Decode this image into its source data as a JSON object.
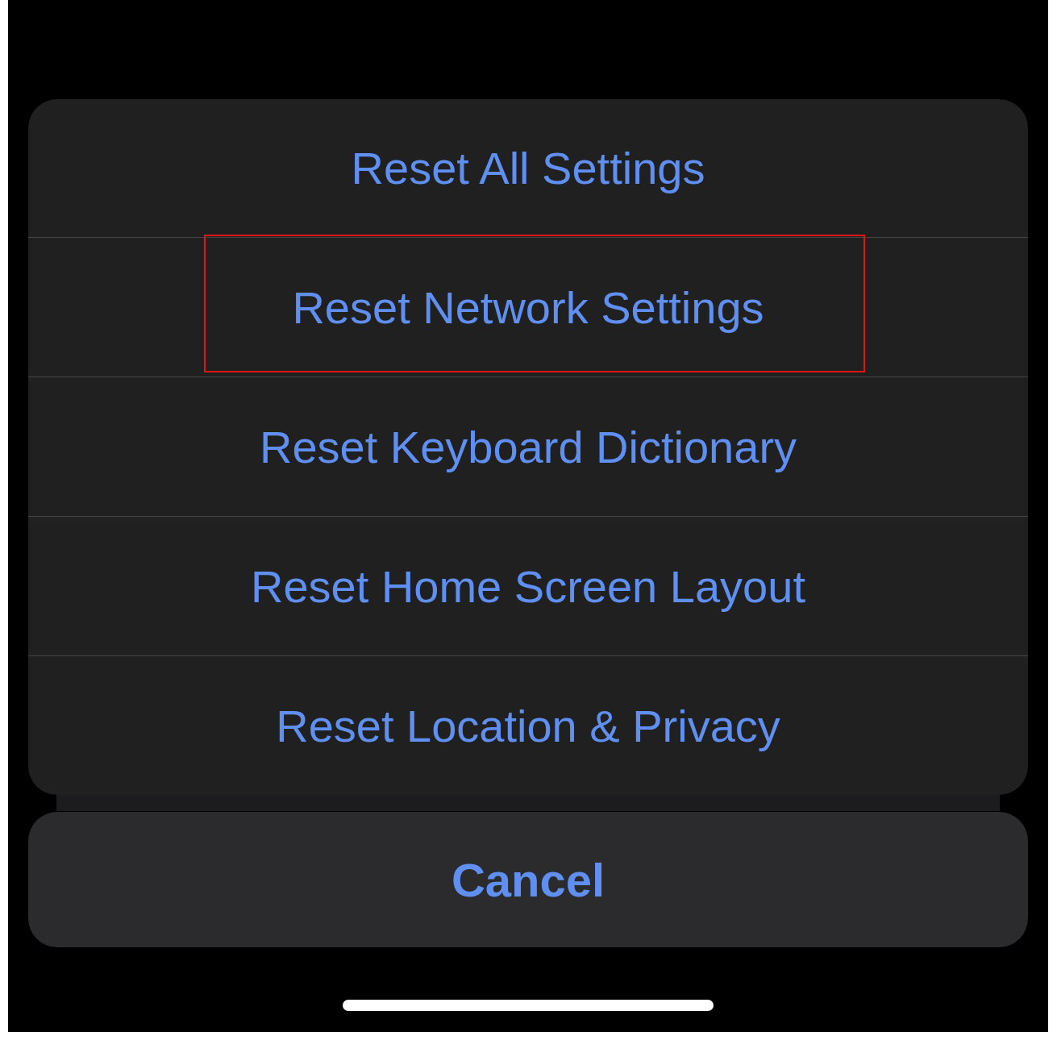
{
  "action_sheet": {
    "options": [
      {
        "label": "Reset All Settings",
        "highlighted": false
      },
      {
        "label": "Reset Network Settings",
        "highlighted": true
      },
      {
        "label": "Reset Keyboard Dictionary",
        "highlighted": false
      },
      {
        "label": "Reset Home Screen Layout",
        "highlighted": false
      },
      {
        "label": "Reset Location & Privacy",
        "highlighted": false
      }
    ]
  },
  "cancel_button": {
    "label": "Cancel"
  }
}
